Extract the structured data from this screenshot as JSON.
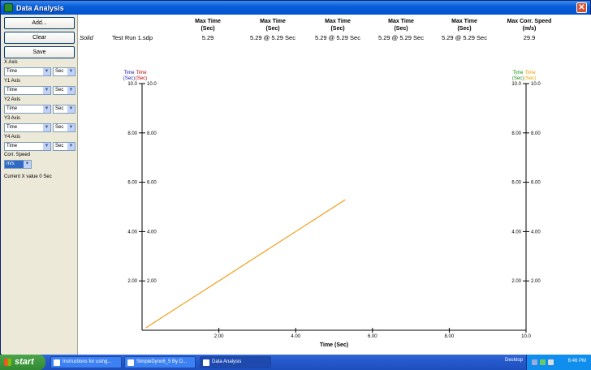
{
  "window": {
    "title": "Data Analysis",
    "close_label": "✕"
  },
  "sidebar": {
    "add_label": "Add...",
    "clear_label": "Clear",
    "save_label": "Save",
    "axes": [
      {
        "label": "X Axis",
        "field": "Time",
        "unit": "Sec"
      },
      {
        "label": "Y1 Axis",
        "field": "Time",
        "unit": "Sec"
      },
      {
        "label": "Y2 Axis",
        "field": "Time",
        "unit": "Sec"
      },
      {
        "label": "Y3 Axis",
        "field": "Time",
        "unit": "Sec"
      },
      {
        "label": "Y4 Axis",
        "field": "Time",
        "unit": "Sec"
      }
    ],
    "corr_speed_label": "Corr. Speed",
    "corr_speed_value": "m/s",
    "current_x_label": "Current X value  0 Sec"
  },
  "table": {
    "headers": [
      "Max Time\n(Sec)",
      "Max Time\n(Sec)",
      "Max Time\n(Sec)",
      "Max Time\n(Sec)",
      "Max Time\n(Sec)",
      "Max Corr. Speed\n(m/s)"
    ],
    "row": {
      "label": "Solid",
      "name": "Test Run 1.sdp",
      "values": [
        "5.29",
        "5.29 @ 5.29 Sec",
        "5.29 @ 5.29 Sec",
        "5.29 @ 5.29 Sec",
        "5.29 @ 5.29 Sec",
        "29.9"
      ]
    }
  },
  "chart_data": {
    "type": "line",
    "xlabel": "Time (Sec)",
    "xlim": [
      0,
      10
    ],
    "ylim": [
      0,
      10
    ],
    "x_ticks": [
      "2.00",
      "4.00",
      "6.00",
      "8.00",
      "10.0"
    ],
    "y_ticks": [
      "2.00",
      "4.00",
      "6.00",
      "8.00",
      "10.0"
    ],
    "left_axis_titles": [
      {
        "text": "Time\n(Sec)",
        "color": "#1A1AB0"
      },
      {
        "text": "Time\n(Sec)",
        "color": "#C00000"
      }
    ],
    "right_axis_titles": [
      {
        "text": "Time\n(Sec)",
        "color": "#1E8A1E"
      },
      {
        "text": "Time\n(Sec)",
        "color": "#E8A000"
      }
    ],
    "series": [
      {
        "color": "#F0A020",
        "x": [
          0.1,
          5.29
        ],
        "y": [
          0.1,
          5.29
        ]
      }
    ]
  },
  "taskbar": {
    "start_label": "start",
    "tasks": [
      {
        "label": "Instructions for using...",
        "active": false
      },
      {
        "label": "SimpleDyno6_5 By D...",
        "active": false
      },
      {
        "label": "Data Analysis",
        "active": true
      }
    ],
    "desktop_label": "Desktop",
    "clock": "6:46 PM"
  }
}
